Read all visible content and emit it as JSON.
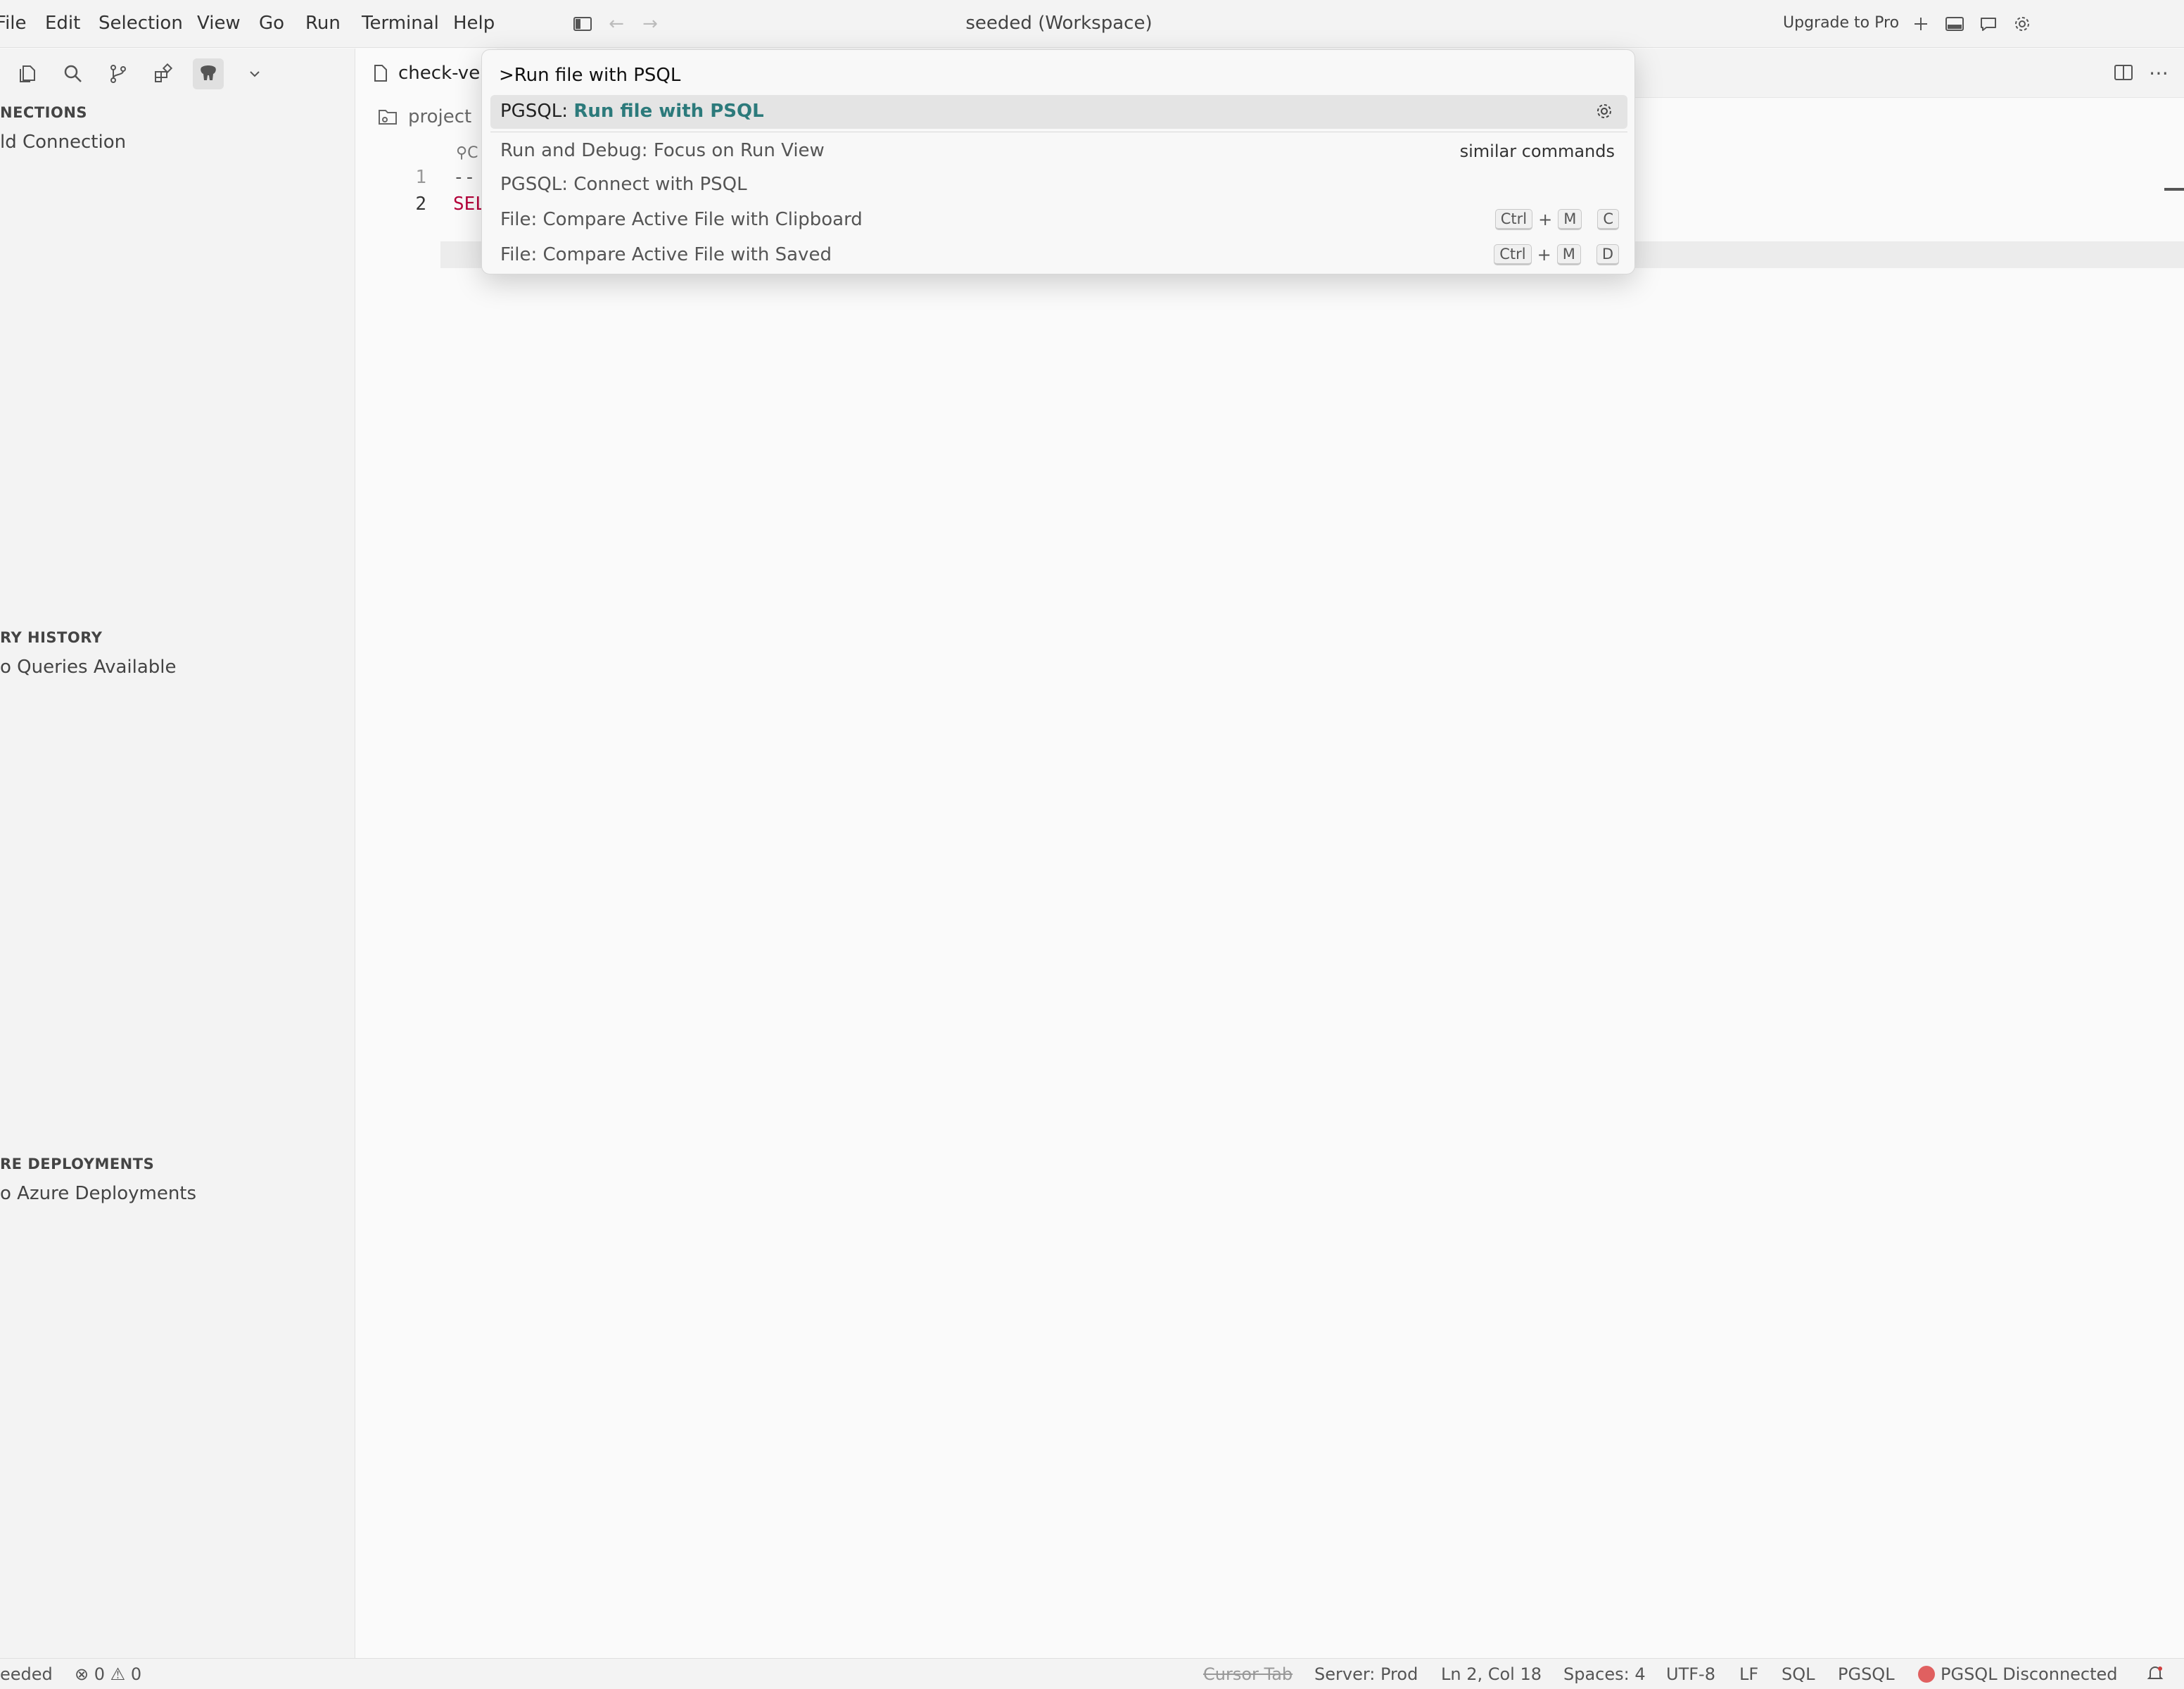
{
  "menu": {
    "file": "File",
    "edit": "Edit",
    "selection": "Selection",
    "view": "View",
    "go": "Go",
    "run": "Run",
    "terminal": "Terminal",
    "help": "Help"
  },
  "window_title": "seeded (Workspace)",
  "upgrade_label": "Upgrade to Pro",
  "sidebar": {
    "connections_header": "NECTIONS",
    "add_connection": "ld Connection",
    "history_header": "RY HISTORY",
    "no_queries": "o Queries Available",
    "azure_header": "RE DEPLOYMENTS",
    "no_azure": "o Azure Deployments"
  },
  "editor": {
    "tab_label": "check-ve",
    "breadcrumb": "project",
    "codelens": "C",
    "lines": [
      {
        "number": "1",
        "text": "--"
      },
      {
        "number": "2",
        "text": "SEL"
      }
    ]
  },
  "palette": {
    "input_value": ">Run file with PSQL",
    "items": [
      {
        "prefix": "PGSQL: ",
        "highlight": "Run file with PSQL"
      },
      {
        "label": "Run and Debug: Focus on Run View",
        "right": "similar commands"
      },
      {
        "label": "PGSQL: Connect with PSQL"
      },
      {
        "label": "File: Compare Active File with Clipboard",
        "keys": [
          "Ctrl",
          "+",
          "M",
          "C"
        ]
      },
      {
        "label": "File: Compare Active File with Saved",
        "keys": [
          "Ctrl",
          "+",
          "M",
          "D"
        ]
      }
    ]
  },
  "status": {
    "workspace": "eeded",
    "errors": "0",
    "warnings": "0",
    "cursor_tab": "Cursor Tab",
    "server": "Server: Prod",
    "position": "Ln 2, Col 18",
    "spaces": "Spaces: 4",
    "encoding": "UTF-8",
    "eol": "LF",
    "language": "SQL",
    "pgsql": "PGSQL",
    "connection": "PGSQL Disconnected"
  }
}
